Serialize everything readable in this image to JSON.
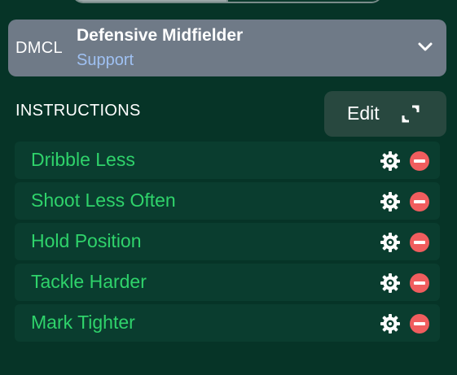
{
  "role": {
    "code": "DMCL",
    "name": "Defensive Midfielder",
    "duty": "Support"
  },
  "instructions": {
    "title": "INSTRUCTIONS",
    "edit_label": "Edit",
    "items": [
      {
        "label": "Dribble Less"
      },
      {
        "label": "Shoot Less Often"
      },
      {
        "label": "Hold Position"
      },
      {
        "label": "Tackle Harder"
      },
      {
        "label": "Mark Tighter"
      }
    ]
  },
  "icons": {
    "role_toggle": "chevron-down-icon",
    "edit": "expand-icon",
    "settings": "gear-icon",
    "remove": "remove-circle-icon"
  },
  "colors": {
    "background": "#063427",
    "role_panel": "#6f7a87",
    "duty_text": "#9fc1f3",
    "instruction_text": "#2fd36b",
    "remove": "#f05d5e"
  }
}
